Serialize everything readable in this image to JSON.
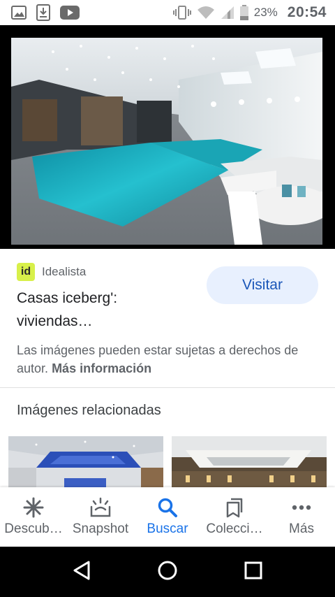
{
  "status_bar": {
    "battery_percent": "23%",
    "time": "20:54",
    "left_icons": [
      "gallery-icon",
      "download-icon",
      "youtube-icon"
    ],
    "right_icons": [
      "vibrate-icon",
      "wifi-icon",
      "signal-icon",
      "battery-icon"
    ]
  },
  "result": {
    "source_logo_text": "id",
    "source_name": "Idealista",
    "title": "Casas iceberg': viviendas…",
    "visit_label": "Visitar",
    "copyright_text": "Las imágenes pueden estar sujetas a derechos de autor.",
    "more_info_label": "Más información"
  },
  "related": {
    "heading": "Imágenes relacionadas"
  },
  "bottom_nav": {
    "items": [
      {
        "label": "Descub…",
        "icon": "sparkle-icon",
        "active": false
      },
      {
        "label": "Snapshot",
        "icon": "snapshot-icon",
        "active": false
      },
      {
        "label": "Buscar",
        "icon": "search-icon",
        "active": true
      },
      {
        "label": "Colecci…",
        "icon": "bookmarks-icon",
        "active": false
      },
      {
        "label": "Más",
        "icon": "more-dots-icon",
        "active": false
      }
    ]
  },
  "system_nav": {
    "icons": [
      "back-icon",
      "home-icon",
      "recents-icon"
    ]
  },
  "colors": {
    "accent": "#1a73e8",
    "visit_button_bg": "#e8f0fe",
    "source_logo_bg": "#d8f04a",
    "pool_water": "#1fb3c4"
  }
}
